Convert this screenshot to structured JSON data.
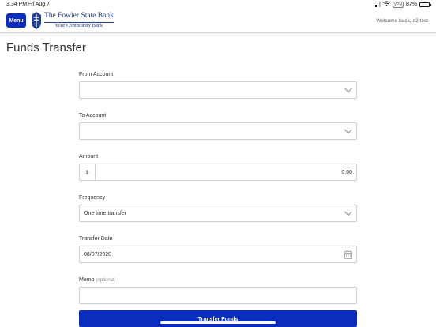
{
  "status_bar": {
    "time": "3:34 PM",
    "date": "Fri Aug 7",
    "battery_percent": "87%",
    "vpn": "VPN"
  },
  "header": {
    "menu_label": "Menu",
    "bank_name": "The Fowler State Bank",
    "tagline": "Your Community Bank",
    "welcome": "Welcome back, q2 test",
    "brand_color": "#0a2dbf"
  },
  "page": {
    "title": "Funds Transfer"
  },
  "form": {
    "from_account": {
      "label": "From Account",
      "value": ""
    },
    "to_account": {
      "label": "To Account",
      "value": ""
    },
    "amount": {
      "label": "Amount",
      "currency": "$",
      "value": "0.00"
    },
    "frequency": {
      "label": "Frequency",
      "value": "One time transfer"
    },
    "transfer_date": {
      "label": "Transfer Date",
      "value": "08/07/2020"
    },
    "memo": {
      "label": "Memo",
      "optional": "(optional)",
      "value": ""
    },
    "submit_label": "Transfer Funds"
  },
  "icons": {
    "from_account": "chevron-down-icon",
    "to_account": "chevron-down-icon",
    "frequency": "chevron-down-icon",
    "transfer_date": "calendar-icon"
  }
}
